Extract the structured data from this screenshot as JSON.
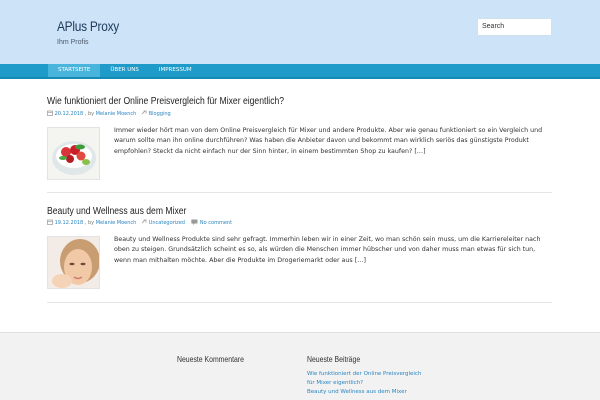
{
  "header": {
    "site_title": "APlus Proxy",
    "site_description": "Ihm Profis",
    "search_placeholder": "Search"
  },
  "nav": {
    "items": [
      {
        "label": "Startseite",
        "active": true
      },
      {
        "label": "Über uns",
        "active": false
      },
      {
        "label": "Impressum",
        "active": false
      }
    ]
  },
  "posts": [
    {
      "title": "Wie funktioniert der Online Preisvergleich für Mixer eigentlich?",
      "date": "20.12.2018",
      "author_prefix": ", by",
      "author": "Melanie Moench",
      "category": "Blogging",
      "comments": "",
      "thumb": "fruit-bowl-icon",
      "excerpt": "Immer wieder hört man von dem Online Preisvergleich für Mixer und andere Produkte. Aber wie genau funktioniert so ein Vergleich und warum sollte man ihn online durchführen? Was haben die Anbieter davon und bekommt man wirklich seriös das günstigste Produkt empfohlen? Steckt da nicht einfach nur der Sinn hinter, in einem bestimmten Shop zu kaufen? […]"
    },
    {
      "title": "Beauty und Wellness aus dem Mixer",
      "date": "19.12.2018",
      "author_prefix": ", by",
      "author": "Melanie Moench",
      "category": "Uncategorized",
      "comments": "No comment",
      "thumb": "woman-face-icon",
      "excerpt": "Beauty und Wellness Produkte sind sehr gefragt. Immerhin leben wir in einer Zeit, wo man schön sein muss, um die Karriereleiter nach oben zu steigen. Grundsätzlich scheint es so, als würden die Menschen immer hübscher und von daher muss man etwas für sich tun, wenn man mithalten möchte. Aber die Produkte im Drogeriemarkt oder aus […]"
    }
  ],
  "footer": {
    "comments_title": "Neueste Kommentare",
    "recent_title": "Neueste Beiträge",
    "recent_posts": [
      "Wie funktioniert der Online Preisvergleich",
      "für Mixer eigentlich?",
      "Beauty und Wellness aus dem Mixer"
    ]
  },
  "colors": {
    "header_bg": "#cde3f8",
    "nav_bg": "#1e9bc8",
    "nav_active": "#49b5dd",
    "link": "#2a85c2",
    "footer_bg": "#f2f2f2"
  }
}
